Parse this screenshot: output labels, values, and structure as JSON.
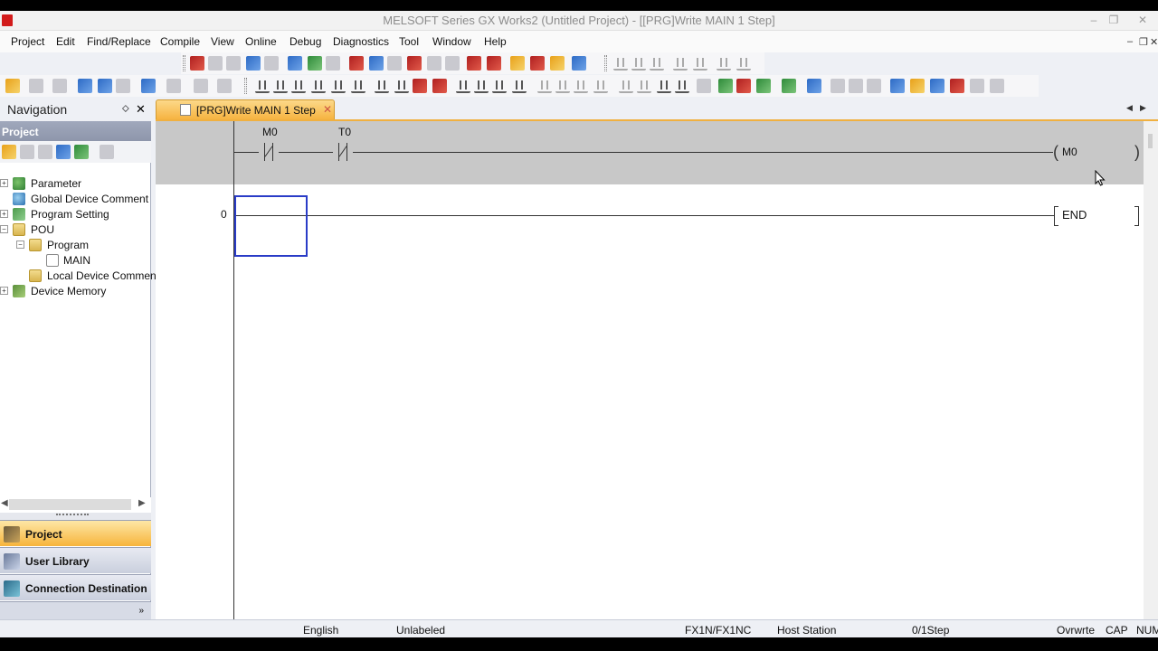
{
  "window": {
    "title": "MELSOFT Series GX Works2 (Untitled Project) - [[PRG]Write MAIN 1 Step]",
    "minimize": "–",
    "restore": "❐",
    "close": "✕"
  },
  "menu": {
    "items": [
      "Project",
      "Edit",
      "Find/Replace",
      "Compile",
      "View",
      "Online",
      "Debug",
      "Diagnostics",
      "Tool",
      "Window",
      "Help"
    ],
    "mdi_min": "–",
    "mdi_restore": "❐",
    "mdi_close": "✕"
  },
  "navigation": {
    "title": "Navigation",
    "pin": "⬦",
    "close": "✕",
    "section": "Project",
    "tree": [
      {
        "label": "Parameter",
        "expander": "+",
        "icon": "parameter-icon"
      },
      {
        "label": "Global Device Comment",
        "expander": "",
        "icon": "comment-icon"
      },
      {
        "label": "Program Setting",
        "expander": "+",
        "icon": "setting-icon"
      },
      {
        "label": "POU",
        "expander": "−",
        "icon": "folder-icon"
      },
      {
        "label": "Program",
        "expander": "−",
        "icon": "folder-icon"
      },
      {
        "label": "MAIN",
        "expander": "",
        "icon": "program-icon"
      },
      {
        "label": "Local Device Commen",
        "expander": "",
        "icon": "folder-icon"
      },
      {
        "label": "Device Memory",
        "expander": "+",
        "icon": "memory-icon"
      }
    ],
    "panes": {
      "project": "Project",
      "user_library": "User Library",
      "connection": "Connection Destination"
    },
    "more": "»",
    "scroll_left": "◀",
    "scroll_right": "▶"
  },
  "tab": {
    "label": "[PRG]Write MAIN 1 Step",
    "close": "✕",
    "nav_left": "◀",
    "nav_right": "▶"
  },
  "ladder": {
    "edit_rung": {
      "contact1": "M0",
      "contact2": "T0",
      "coil": "M0"
    },
    "end_rung": {
      "step": "0",
      "instruction": "END"
    }
  },
  "status": {
    "language": "English",
    "label": "Unlabeled",
    "plc_type": "FX1N/FX1NC",
    "station": "Host Station",
    "steps": "0/1Step",
    "mode": "Ovrwrte",
    "caps": "CAP",
    "num": "NUM"
  },
  "colors": {
    "tab_active": "#f6b341",
    "cursor": "#2a3cc7",
    "edit_rung_bg": "#c8c8c8"
  }
}
